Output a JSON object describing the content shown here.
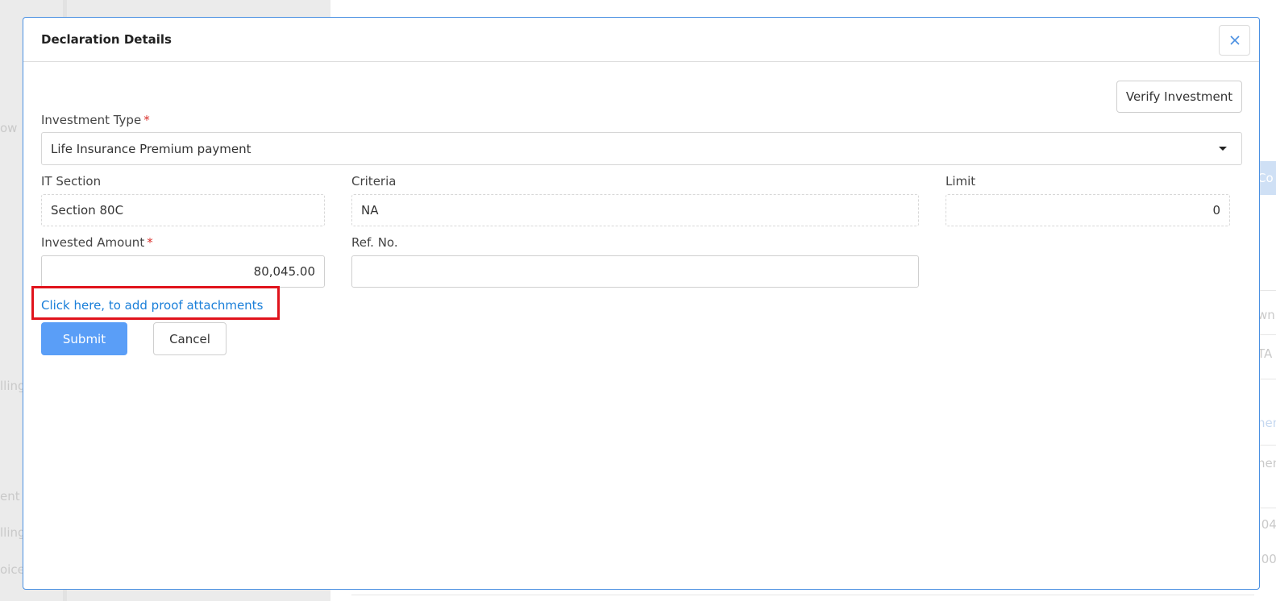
{
  "background": {
    "fragments": [
      "ow",
      "lling",
      "ent",
      "lling",
      "oice",
      "Co",
      "wnl",
      "TA",
      "nen",
      "nen",
      ".04",
      ".00"
    ]
  },
  "modal": {
    "title": "Declaration Details",
    "close_icon": "close-icon",
    "verify_button_label": "Verify Investment"
  },
  "form": {
    "investment_type": {
      "label": "Investment Type",
      "required_mark": "*",
      "selected": "Life Insurance Premium payment",
      "dropdown_icon": "caret-down-icon"
    },
    "it_section": {
      "label": "IT Section",
      "value": "Section 80C"
    },
    "criteria": {
      "label": "Criteria",
      "value": "NA"
    },
    "limit": {
      "label": "Limit",
      "value": "0"
    },
    "invested_amount": {
      "label": "Invested Amount",
      "required_mark": "*",
      "value": "80,045.00"
    },
    "ref_no": {
      "label": "Ref. No.",
      "value": ""
    },
    "proof_link": "Click here, to add proof attachments",
    "submit_label": "Submit",
    "cancel_label": "Cancel"
  },
  "colors": {
    "primary": "#5a9ef7",
    "link": "#1a7fd9",
    "required": "#d9302c",
    "highlight": "#e0131c",
    "modal_border": "#4a90e2"
  }
}
